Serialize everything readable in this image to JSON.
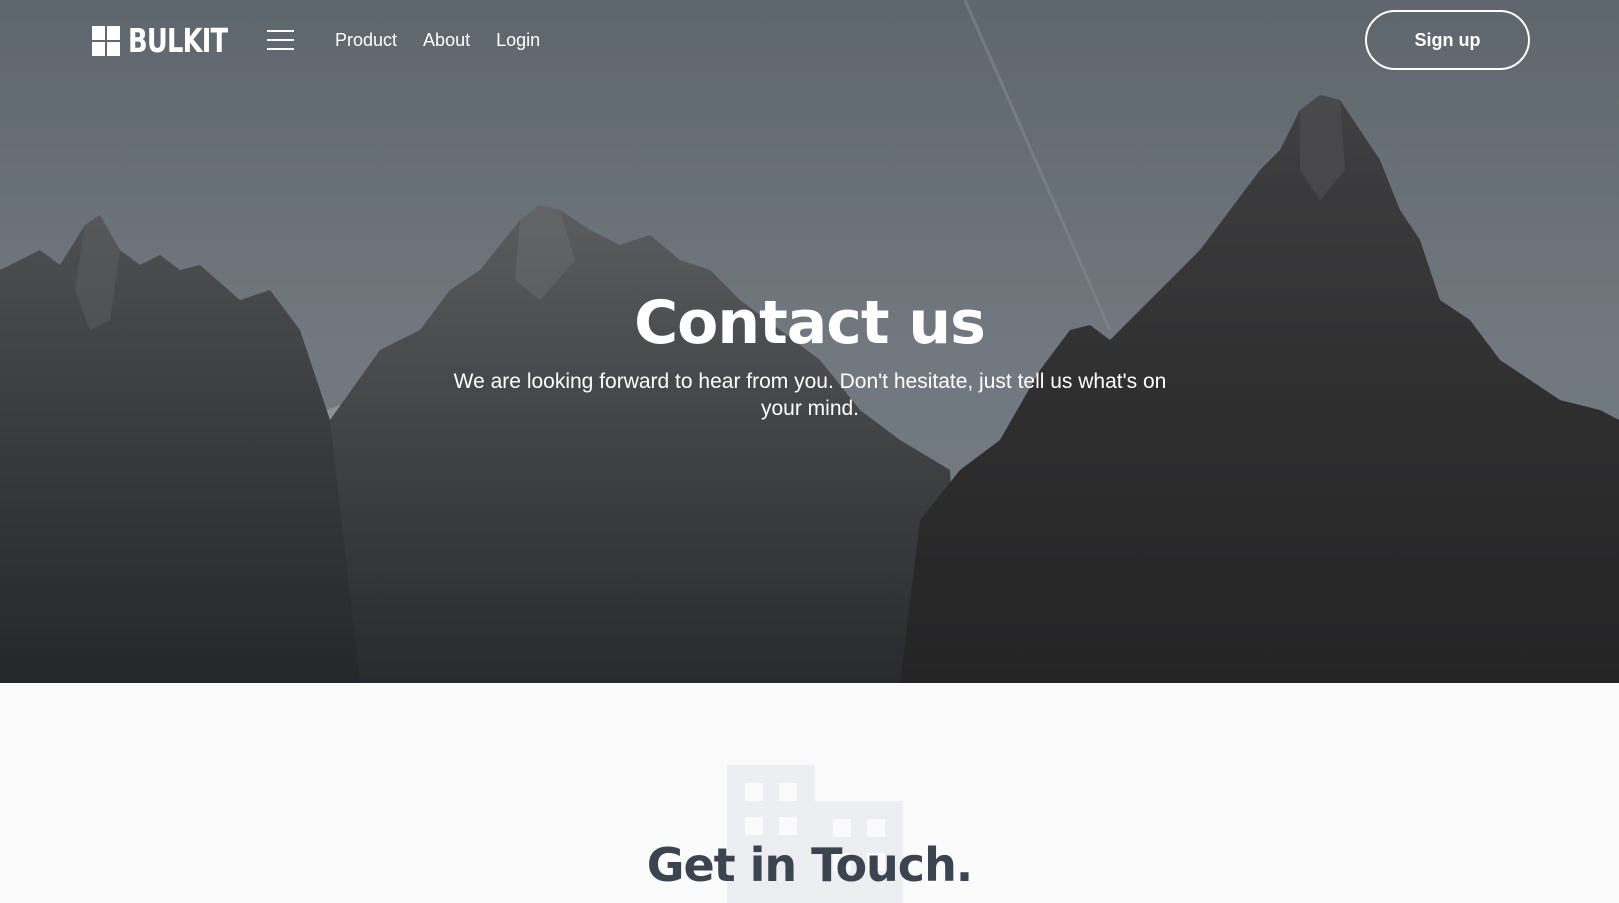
{
  "nav": {
    "logo_text": "BULKIT",
    "links": [
      "Product",
      "About",
      "Login"
    ],
    "signup_label": "Sign up"
  },
  "hero": {
    "title": "Contact us",
    "subtitle": "We are looking forward to hear from you. Don't hesitate, just tell us what's on your mind."
  },
  "section": {
    "title": "Get in Touch."
  },
  "icons": {
    "logo": "grid-logo-icon",
    "menu": "hamburger-menu-icon",
    "background": "building-icon"
  },
  "colors": {
    "heading_dark": "#3b4450",
    "section_bg": "#fbfbfc",
    "white": "#ffffff"
  }
}
